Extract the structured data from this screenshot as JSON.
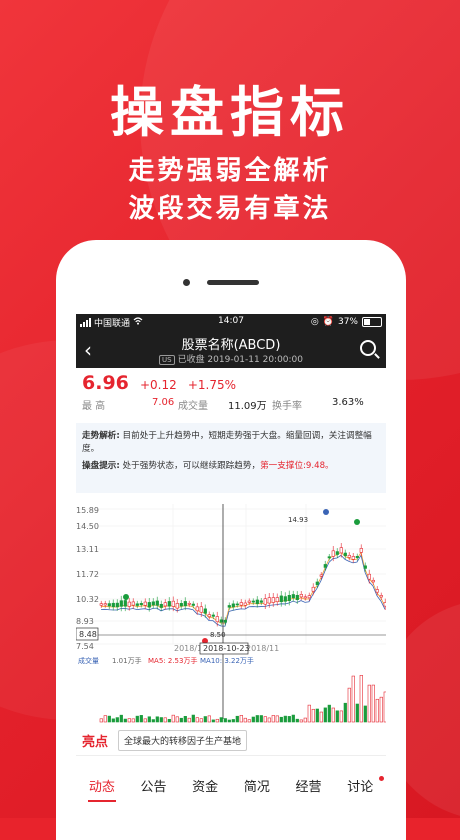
{
  "hero": {
    "title": "操盘指标",
    "line1": "走势强弱全解析",
    "line2": "波段交易有章法"
  },
  "status": {
    "carrier": "中国联通",
    "time": "14:07",
    "battery": "37%"
  },
  "nav": {
    "title": "股票名称(ABCD)",
    "market": "US",
    "subtitle": "已收盘 2019-01-11 20:00:00"
  },
  "quote": {
    "price": "6.96",
    "change": "+0.12",
    "change_pct": "+1.75%",
    "high_label": "最  高",
    "high_value": "7.06",
    "volume_label": "成交量",
    "volume_value": "11.09万",
    "turnover_label": "换手率",
    "turnover_value": "3.63%"
  },
  "analysis": {
    "trend_label": "走势解析:",
    "trend_text": "目前处于上升趋势中，短期走势强于大盘。缩量回调，关注调整幅度。",
    "tip_label": "操盘提示:",
    "tip_text": "处于强势状态，可以继续跟踪趋势，",
    "tip_highlight": "第一支撑位:9.48。"
  },
  "chart": {
    "y_ticks": [
      "15.89",
      "14.50",
      "13.11",
      "11.72",
      "10.32",
      "8.93",
      "7.54"
    ],
    "current_line_label": "8.48",
    "low_label": "8.50",
    "high_label": "14.93",
    "x_labels": [
      "2018/10",
      "2018/11"
    ],
    "crosshair_date": "2018-10-23",
    "vol_label": "成交量",
    "vol_value": "1.01万手",
    "ma5_label": "MA5: 2.53万手",
    "ma10_label": "MA10: 3.22万手"
  },
  "highlight": {
    "label": "亮点",
    "tag": "全球最大的转移因子生产基地"
  },
  "tabs": [
    "动态",
    "公告",
    "资金",
    "简况",
    "经营",
    "讨论"
  ],
  "colors": {
    "brand": "#e5252f",
    "up": "#e5252f",
    "down": "#1a9c3c"
  }
}
